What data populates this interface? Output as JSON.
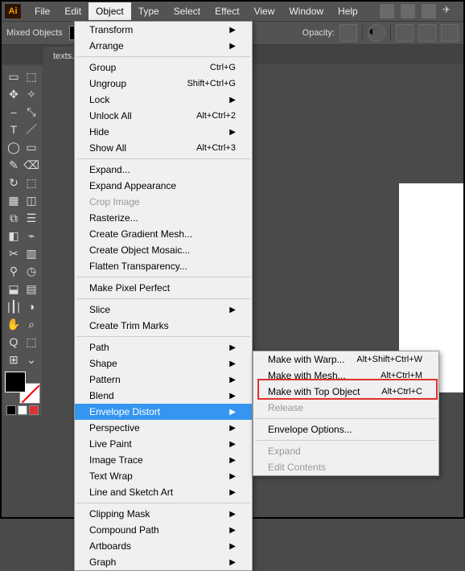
{
  "menubar": {
    "items": [
      "File",
      "Edit",
      "Object",
      "Type",
      "Select",
      "Effect",
      "View",
      "Window",
      "Help"
    ],
    "active_index": 2
  },
  "options": {
    "selection_label": "Mixed Objects",
    "opacity_label": "Opacity:"
  },
  "tab": {
    "label": "texts."
  },
  "tools": {
    "glyphs": [
      "▭",
      "⬚",
      "✥",
      "✧",
      "⎯",
      "⤡",
      "T",
      "／",
      "◯",
      "▭",
      "✎",
      "⌫",
      "↻",
      "⬚",
      "▦",
      "◫",
      "⧉",
      "☰",
      "◧",
      "⌁",
      "✂",
      "▥",
      "⚲",
      "◷",
      "⬓",
      "▤",
      "|┃|",
      "◑",
      "✋",
      "⌕",
      "Q",
      "⬚",
      "⊞",
      "⌄"
    ]
  },
  "mini_swatches": [
    "#000",
    "#fff",
    "#e03030"
  ],
  "object_menu": [
    {
      "label": "Transform",
      "arrow": true
    },
    {
      "label": "Arrange",
      "arrow": true
    },
    {
      "sep": true
    },
    {
      "label": "Group",
      "shortcut": "Ctrl+G"
    },
    {
      "label": "Ungroup",
      "shortcut": "Shift+Ctrl+G"
    },
    {
      "label": "Lock",
      "arrow": true
    },
    {
      "label": "Unlock All",
      "shortcut": "Alt+Ctrl+2"
    },
    {
      "label": "Hide",
      "arrow": true
    },
    {
      "label": "Show All",
      "shortcut": "Alt+Ctrl+3"
    },
    {
      "sep": true
    },
    {
      "label": "Expand..."
    },
    {
      "label": "Expand Appearance"
    },
    {
      "label": "Crop Image",
      "disabled": true
    },
    {
      "label": "Rasterize..."
    },
    {
      "label": "Create Gradient Mesh..."
    },
    {
      "label": "Create Object Mosaic..."
    },
    {
      "label": "Flatten Transparency..."
    },
    {
      "sep": true
    },
    {
      "label": "Make Pixel Perfect"
    },
    {
      "sep": true
    },
    {
      "label": "Slice",
      "arrow": true
    },
    {
      "label": "Create Trim Marks"
    },
    {
      "sep": true
    },
    {
      "label": "Path",
      "arrow": true
    },
    {
      "label": "Shape",
      "arrow": true
    },
    {
      "label": "Pattern",
      "arrow": true
    },
    {
      "label": "Blend",
      "arrow": true
    },
    {
      "label": "Envelope Distort",
      "arrow": true,
      "hover": true
    },
    {
      "label": "Perspective",
      "arrow": true
    },
    {
      "label": "Live Paint",
      "arrow": true
    },
    {
      "label": "Image Trace",
      "arrow": true
    },
    {
      "label": "Text Wrap",
      "arrow": true
    },
    {
      "label": "Line and Sketch Art",
      "arrow": true
    },
    {
      "sep": true
    },
    {
      "label": "Clipping Mask",
      "arrow": true
    },
    {
      "label": "Compound Path",
      "arrow": true
    },
    {
      "label": "Artboards",
      "arrow": true
    },
    {
      "label": "Graph",
      "arrow": true
    }
  ],
  "envelope_submenu": [
    {
      "label": "Make with Warp...",
      "shortcut": "Alt+Shift+Ctrl+W"
    },
    {
      "label": "Make with Mesh...",
      "shortcut": "Alt+Ctrl+M"
    },
    {
      "label": "Make with Top Object",
      "shortcut": "Alt+Ctrl+C",
      "highlight": true
    },
    {
      "label": "Release",
      "disabled": true
    },
    {
      "sep": true
    },
    {
      "label": "Envelope Options..."
    },
    {
      "sep": true
    },
    {
      "label": "Expand",
      "disabled": true
    },
    {
      "label": "Edit Contents",
      "disabled": true
    }
  ],
  "logo": "Ai"
}
